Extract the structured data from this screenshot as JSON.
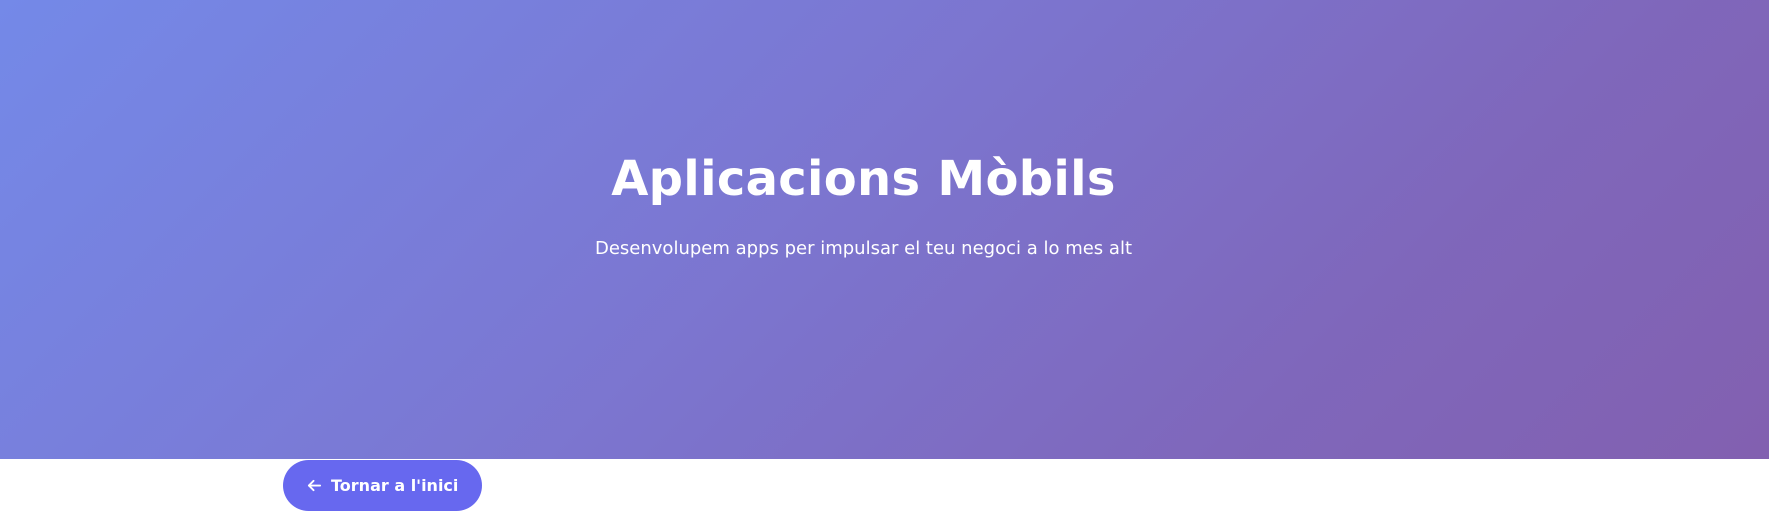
{
  "hero": {
    "title": "Aplicacions Mòbils",
    "subtitle": "Desenvolupem apps per impulsar el teu negoci a lo mes alt",
    "gradient_start": "#7489e8",
    "gradient_end": "#8260b0"
  },
  "back_button": {
    "label": "Tornar a l'inici",
    "icon": "arrow-left-icon",
    "color": "#6768ef"
  }
}
